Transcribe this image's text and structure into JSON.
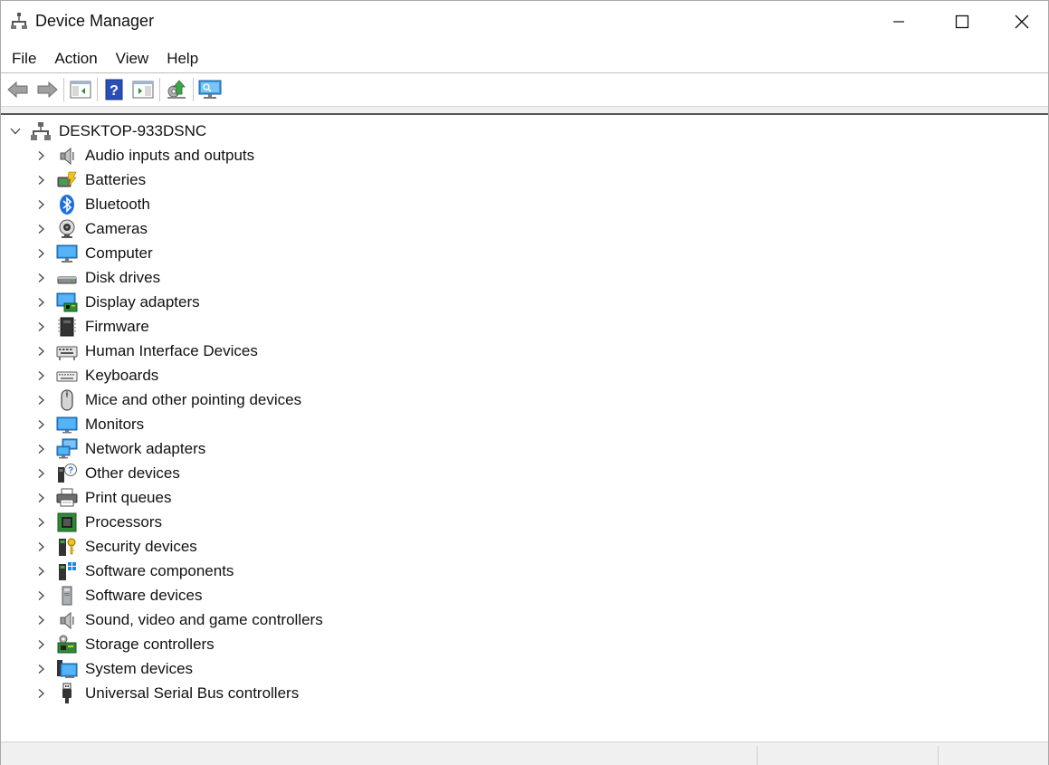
{
  "window": {
    "title": "Device Manager"
  },
  "menu": [
    "File",
    "Action",
    "View",
    "Help"
  ],
  "toolbar": [
    {
      "name": "back-button",
      "icon": "arrow-left-icon"
    },
    {
      "name": "forward-button",
      "icon": "arrow-right-icon"
    },
    {
      "name": "show-hide-console-tree-button",
      "icon": "console-tree-icon"
    },
    {
      "name": "help-button",
      "icon": "help-icon"
    },
    {
      "name": "show-action-pane-button",
      "icon": "action-pane-icon"
    },
    {
      "name": "update-driver-button",
      "icon": "update-driver-icon"
    },
    {
      "name": "scan-hardware-changes-button",
      "icon": "scan-monitor-icon"
    }
  ],
  "tree": {
    "root": {
      "label": "DESKTOP-933DSNC",
      "expanded": true,
      "icon": "computer-network-icon"
    },
    "categories": [
      {
        "label": "Audio inputs and outputs",
        "icon": "speaker-icon"
      },
      {
        "label": "Batteries",
        "icon": "battery-icon"
      },
      {
        "label": "Bluetooth",
        "icon": "bluetooth-icon"
      },
      {
        "label": "Cameras",
        "icon": "camera-icon"
      },
      {
        "label": "Computer",
        "icon": "computer-icon"
      },
      {
        "label": "Disk drives",
        "icon": "disk-drive-icon"
      },
      {
        "label": "Display adapters",
        "icon": "display-adapter-icon"
      },
      {
        "label": "Firmware",
        "icon": "firmware-chip-icon"
      },
      {
        "label": "Human Interface Devices",
        "icon": "hid-keyboard-icon"
      },
      {
        "label": "Keyboards",
        "icon": "keyboard-icon"
      },
      {
        "label": "Mice and other pointing devices",
        "icon": "mouse-icon"
      },
      {
        "label": "Monitors",
        "icon": "monitor-icon"
      },
      {
        "label": "Network adapters",
        "icon": "network-adapter-icon"
      },
      {
        "label": "Other devices",
        "icon": "unknown-device-icon"
      },
      {
        "label": "Print queues",
        "icon": "printer-icon"
      },
      {
        "label": "Processors",
        "icon": "processor-icon"
      },
      {
        "label": "Security devices",
        "icon": "security-key-icon"
      },
      {
        "label": "Software components",
        "icon": "software-component-icon"
      },
      {
        "label": "Software devices",
        "icon": "software-device-icon"
      },
      {
        "label": "Sound, video and game controllers",
        "icon": "sound-icon"
      },
      {
        "label": "Storage controllers",
        "icon": "storage-controller-icon"
      },
      {
        "label": "System devices",
        "icon": "system-devices-icon"
      },
      {
        "label": "Universal Serial Bus controllers",
        "icon": "usb-icon"
      }
    ]
  },
  "colors": {
    "accent": "#0078d7",
    "icon_blue": "#1e88e5",
    "icon_green": "#3aa845"
  }
}
